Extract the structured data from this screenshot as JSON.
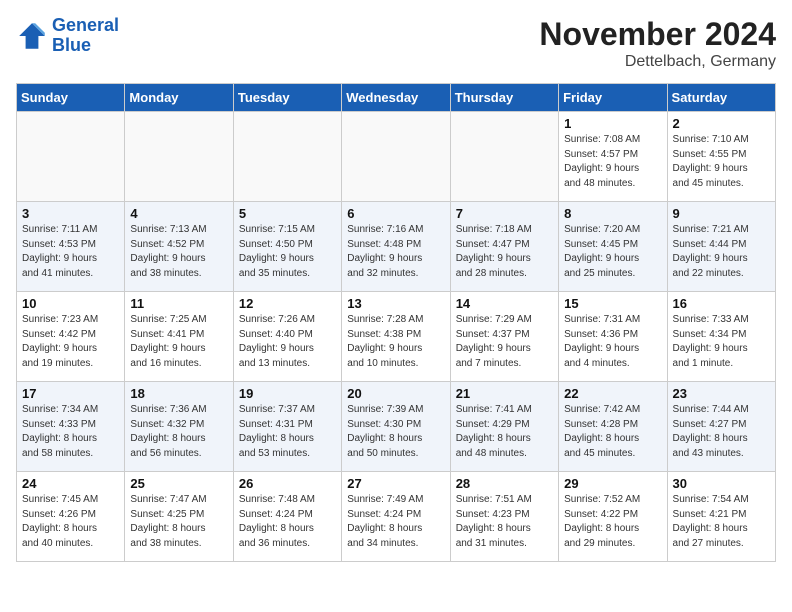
{
  "logo": {
    "line1": "General",
    "line2": "Blue"
  },
  "title": "November 2024",
  "location": "Dettelbach, Germany",
  "weekdays": [
    "Sunday",
    "Monday",
    "Tuesday",
    "Wednesday",
    "Thursday",
    "Friday",
    "Saturday"
  ],
  "weeks": [
    [
      {
        "day": "",
        "info": ""
      },
      {
        "day": "",
        "info": ""
      },
      {
        "day": "",
        "info": ""
      },
      {
        "day": "",
        "info": ""
      },
      {
        "day": "",
        "info": ""
      },
      {
        "day": "1",
        "info": "Sunrise: 7:08 AM\nSunset: 4:57 PM\nDaylight: 9 hours\nand 48 minutes."
      },
      {
        "day": "2",
        "info": "Sunrise: 7:10 AM\nSunset: 4:55 PM\nDaylight: 9 hours\nand 45 minutes."
      }
    ],
    [
      {
        "day": "3",
        "info": "Sunrise: 7:11 AM\nSunset: 4:53 PM\nDaylight: 9 hours\nand 41 minutes."
      },
      {
        "day": "4",
        "info": "Sunrise: 7:13 AM\nSunset: 4:52 PM\nDaylight: 9 hours\nand 38 minutes."
      },
      {
        "day": "5",
        "info": "Sunrise: 7:15 AM\nSunset: 4:50 PM\nDaylight: 9 hours\nand 35 minutes."
      },
      {
        "day": "6",
        "info": "Sunrise: 7:16 AM\nSunset: 4:48 PM\nDaylight: 9 hours\nand 32 minutes."
      },
      {
        "day": "7",
        "info": "Sunrise: 7:18 AM\nSunset: 4:47 PM\nDaylight: 9 hours\nand 28 minutes."
      },
      {
        "day": "8",
        "info": "Sunrise: 7:20 AM\nSunset: 4:45 PM\nDaylight: 9 hours\nand 25 minutes."
      },
      {
        "day": "9",
        "info": "Sunrise: 7:21 AM\nSunset: 4:44 PM\nDaylight: 9 hours\nand 22 minutes."
      }
    ],
    [
      {
        "day": "10",
        "info": "Sunrise: 7:23 AM\nSunset: 4:42 PM\nDaylight: 9 hours\nand 19 minutes."
      },
      {
        "day": "11",
        "info": "Sunrise: 7:25 AM\nSunset: 4:41 PM\nDaylight: 9 hours\nand 16 minutes."
      },
      {
        "day": "12",
        "info": "Sunrise: 7:26 AM\nSunset: 4:40 PM\nDaylight: 9 hours\nand 13 minutes."
      },
      {
        "day": "13",
        "info": "Sunrise: 7:28 AM\nSunset: 4:38 PM\nDaylight: 9 hours\nand 10 minutes."
      },
      {
        "day": "14",
        "info": "Sunrise: 7:29 AM\nSunset: 4:37 PM\nDaylight: 9 hours\nand 7 minutes."
      },
      {
        "day": "15",
        "info": "Sunrise: 7:31 AM\nSunset: 4:36 PM\nDaylight: 9 hours\nand 4 minutes."
      },
      {
        "day": "16",
        "info": "Sunrise: 7:33 AM\nSunset: 4:34 PM\nDaylight: 9 hours\nand 1 minute."
      }
    ],
    [
      {
        "day": "17",
        "info": "Sunrise: 7:34 AM\nSunset: 4:33 PM\nDaylight: 8 hours\nand 58 minutes."
      },
      {
        "day": "18",
        "info": "Sunrise: 7:36 AM\nSunset: 4:32 PM\nDaylight: 8 hours\nand 56 minutes."
      },
      {
        "day": "19",
        "info": "Sunrise: 7:37 AM\nSunset: 4:31 PM\nDaylight: 8 hours\nand 53 minutes."
      },
      {
        "day": "20",
        "info": "Sunrise: 7:39 AM\nSunset: 4:30 PM\nDaylight: 8 hours\nand 50 minutes."
      },
      {
        "day": "21",
        "info": "Sunrise: 7:41 AM\nSunset: 4:29 PM\nDaylight: 8 hours\nand 48 minutes."
      },
      {
        "day": "22",
        "info": "Sunrise: 7:42 AM\nSunset: 4:28 PM\nDaylight: 8 hours\nand 45 minutes."
      },
      {
        "day": "23",
        "info": "Sunrise: 7:44 AM\nSunset: 4:27 PM\nDaylight: 8 hours\nand 43 minutes."
      }
    ],
    [
      {
        "day": "24",
        "info": "Sunrise: 7:45 AM\nSunset: 4:26 PM\nDaylight: 8 hours\nand 40 minutes."
      },
      {
        "day": "25",
        "info": "Sunrise: 7:47 AM\nSunset: 4:25 PM\nDaylight: 8 hours\nand 38 minutes."
      },
      {
        "day": "26",
        "info": "Sunrise: 7:48 AM\nSunset: 4:24 PM\nDaylight: 8 hours\nand 36 minutes."
      },
      {
        "day": "27",
        "info": "Sunrise: 7:49 AM\nSunset: 4:24 PM\nDaylight: 8 hours\nand 34 minutes."
      },
      {
        "day": "28",
        "info": "Sunrise: 7:51 AM\nSunset: 4:23 PM\nDaylight: 8 hours\nand 31 minutes."
      },
      {
        "day": "29",
        "info": "Sunrise: 7:52 AM\nSunset: 4:22 PM\nDaylight: 8 hours\nand 29 minutes."
      },
      {
        "day": "30",
        "info": "Sunrise: 7:54 AM\nSunset: 4:21 PM\nDaylight: 8 hours\nand 27 minutes."
      }
    ]
  ]
}
